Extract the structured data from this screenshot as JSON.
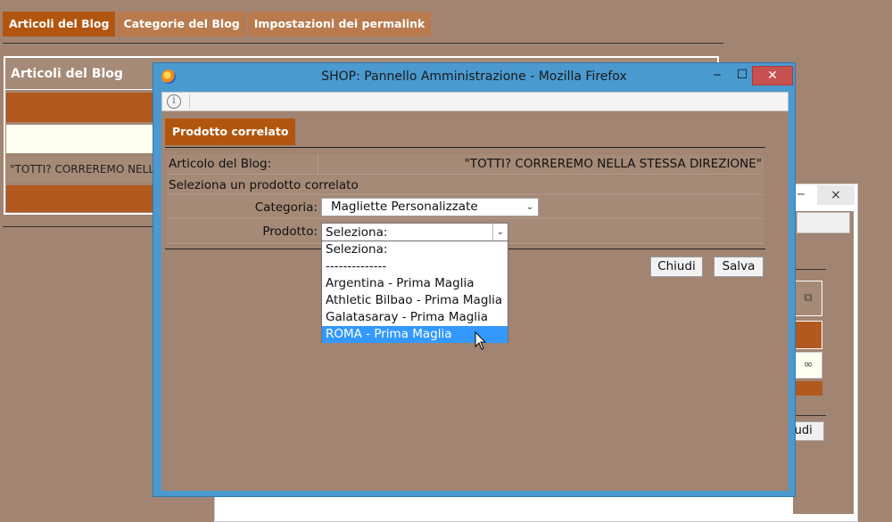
{
  "bg": {
    "tabs": [
      "Articoli del Blog",
      "Categorie del Blog",
      "Impostazioni dei permalink"
    ],
    "panel_title": "Articoli del Blog",
    "row_text": "\"TOTTI? CORREREMO NELL"
  },
  "bg_window2": {
    "close_glyph": "×",
    "button_partial": "iudi"
  },
  "window": {
    "title": "SHOP: Pannello Amministrazione - Mozilla Firefox",
    "minimize_glyph": "‒",
    "maximize_glyph": "☐",
    "close_glyph": "✕",
    "info_glyph": "i"
  },
  "popup": {
    "tab_label": "Prodotto correlato",
    "article_label": "Articolo del Blog:",
    "article_value": "\"TOTTI? CORREREMO NELLA STESSA DIREZIONE\"",
    "instruction": "Seleziona un prodotto correlato",
    "category_label": "Categoria:",
    "category_value": "Magliette Personalizzate",
    "product_label": "Prodotto:",
    "product_value": "Seleziona:",
    "close_button": "Chiudi",
    "save_button": "Salva"
  },
  "dropdown": {
    "options": [
      "Seleziona:",
      "--------------",
      "Argentina - Prima Maglia",
      "Athletic Bilbao - Prima Maglia",
      "Galatasaray - Prima Maglia",
      "ROMA - Prima Maglia"
    ],
    "highlighted_index": 5
  },
  "colors": {
    "page_bg": "#a28472",
    "accent_tab": "#b2560f",
    "window_frame": "#4a9ad0",
    "close_button": "#c75050",
    "highlight": "#3399ff"
  }
}
